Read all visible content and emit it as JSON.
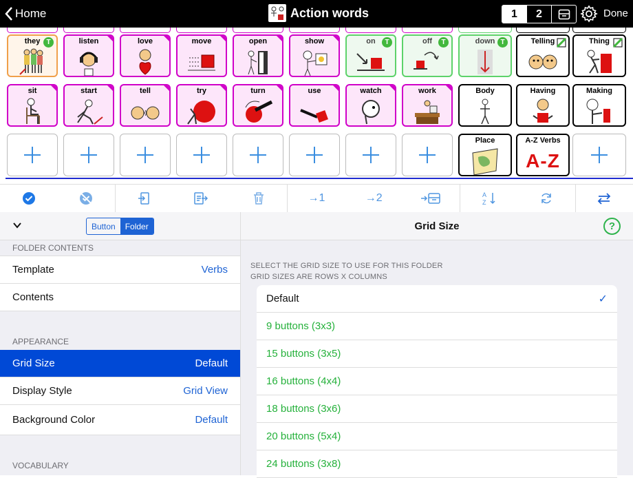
{
  "topbar": {
    "back_label": "Home",
    "title": "Action words",
    "pages": [
      "1",
      "2"
    ],
    "done_label": "Done"
  },
  "grid": {
    "row1": [
      {
        "label": "they",
        "badge": "T"
      },
      {
        "label": "listen"
      },
      {
        "label": "love"
      },
      {
        "label": "move"
      },
      {
        "label": "open"
      },
      {
        "label": "show"
      },
      {
        "label": "on",
        "badge": "T"
      },
      {
        "label": "off",
        "badge": "T"
      },
      {
        "label": "down",
        "badge": "T"
      },
      {
        "label": "Telling"
      },
      {
        "label": "Thing"
      }
    ],
    "row2": [
      {
        "label": "sit"
      },
      {
        "label": "start"
      },
      {
        "label": "tell"
      },
      {
        "label": "try"
      },
      {
        "label": "turn"
      },
      {
        "label": "use"
      },
      {
        "label": "watch"
      },
      {
        "label": "work"
      },
      {
        "label": "Body"
      },
      {
        "label": "Having"
      },
      {
        "label": "Making"
      }
    ],
    "row3": [
      {
        "label": ""
      },
      {
        "label": ""
      },
      {
        "label": ""
      },
      {
        "label": ""
      },
      {
        "label": ""
      },
      {
        "label": ""
      },
      {
        "label": ""
      },
      {
        "label": ""
      },
      {
        "label": "Place"
      },
      {
        "label": "A-Z Verbs",
        "picture_text": "A-Z"
      },
      {
        "label": ""
      }
    ]
  },
  "toolbar": {
    "icons": [
      "check-circle-icon",
      "deselect-circle-icon",
      "import-icon",
      "paste-icon",
      "trash-icon",
      "move-page-1-icon",
      "move-page-2-icon",
      "move-to-folder-icon",
      "sort-az-icon",
      "refresh-icon",
      "swap-icon"
    ],
    "move1": "→1",
    "move2": "→2"
  },
  "left_panel": {
    "segment": [
      "Button",
      "Folder"
    ],
    "selected_segment": "Folder",
    "folder_contents_header": "FOLDER CONTENTS",
    "template_label": "Template",
    "template_value": "Verbs",
    "contents_label": "Contents",
    "appearance_header": "APPEARANCE",
    "grid_size_label": "Grid Size",
    "grid_size_value": "Default",
    "display_style_label": "Display Style",
    "display_style_value": "Grid View",
    "background_color_label": "Background Color",
    "background_color_value": "Default",
    "vocabulary_header": "VOCABULARY"
  },
  "right_panel": {
    "title": "Grid Size",
    "help": "?",
    "section_line1": "SELECT THE GRID SIZE TO USE FOR THIS FOLDER",
    "section_line2": "GRID SIZES ARE ROWS X COLUMNS",
    "options": [
      "Default",
      "9 buttons (3x3)",
      "15 buttons (3x5)",
      "16 buttons (4x4)",
      "18 buttons (3x6)",
      "20 buttons (5x4)",
      "24 buttons (3x8)"
    ],
    "selected_index": 0,
    "check": "✓"
  },
  "colors": {
    "folder_magenta": "#d000c8",
    "toggle_green": "#42b83d",
    "selection_blue": "#0049d6",
    "link_blue": "#1e63d4",
    "option_green": "#25b13b"
  }
}
